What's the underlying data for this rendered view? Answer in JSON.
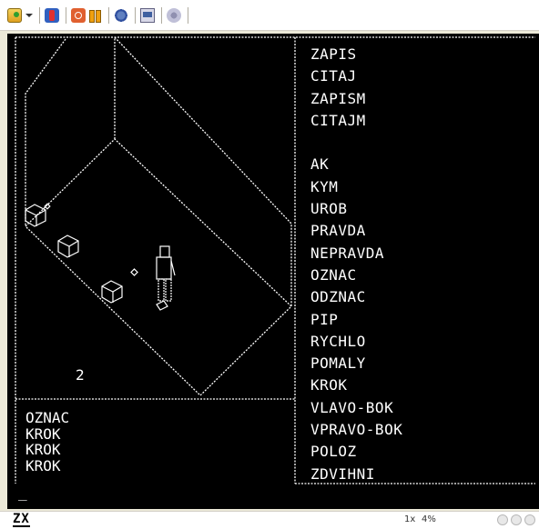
{
  "toolbar": {
    "buttons": [
      {
        "name": "open-icon"
      },
      {
        "name": "dropdown-caret-icon"
      },
      {
        "name": "user-icon"
      },
      {
        "name": "power-icon"
      },
      {
        "name": "pause-icon"
      },
      {
        "name": "gear-icon"
      },
      {
        "name": "screen-icon"
      },
      {
        "name": "network-icon"
      }
    ]
  },
  "screen": {
    "menu_items": [
      "ZAPIS",
      "CITAJ",
      "ZAPISM",
      "CITAJM",
      "",
      "AK",
      "KYM",
      "UROB",
      "PRAVDA",
      "NEPRAVDA",
      "OZNAC",
      "ODZNAC",
      "PIP",
      "RYCHLO",
      "POMALY",
      "KROK",
      "VLAVO-BOK",
      "VPRAVO-BOK",
      "POLOZ",
      "ZDVIHNI"
    ],
    "page_number": "2",
    "history": [
      "OZNAC",
      "KROK",
      "KROK",
      "KROK"
    ],
    "prompt": "_"
  },
  "statusbar": {
    "logo": "ZX",
    "speed": "1x",
    "percent": "4%"
  },
  "colors": {
    "screen_bg": "#000000",
    "screen_fg": "#ffffff",
    "chrome": "#ece9d8"
  }
}
